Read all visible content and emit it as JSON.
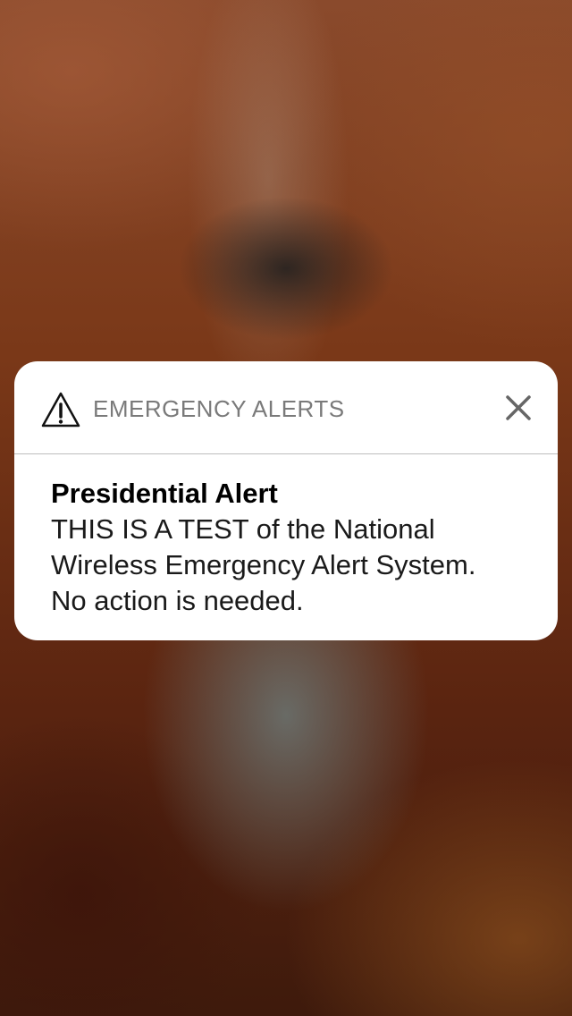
{
  "background": {
    "description_colors": {
      "top": "#8a4a2c",
      "middle": "#7a3818",
      "bottom": "#3e1a0c"
    }
  },
  "notification": {
    "app_name": "EMERGENCY ALERTS",
    "header_icon": "warning-triangle-icon",
    "close_icon": "close-icon",
    "title": "Presidential Alert",
    "message_lines": [
      "THIS IS A TEST of the National",
      "Wireless Emergency Alert System.",
      "No action is needed."
    ],
    "colors": {
      "card": "#ffffff",
      "app_name": "#7a7a7a",
      "title": "#000000",
      "divider": "#bdbdbd"
    }
  }
}
